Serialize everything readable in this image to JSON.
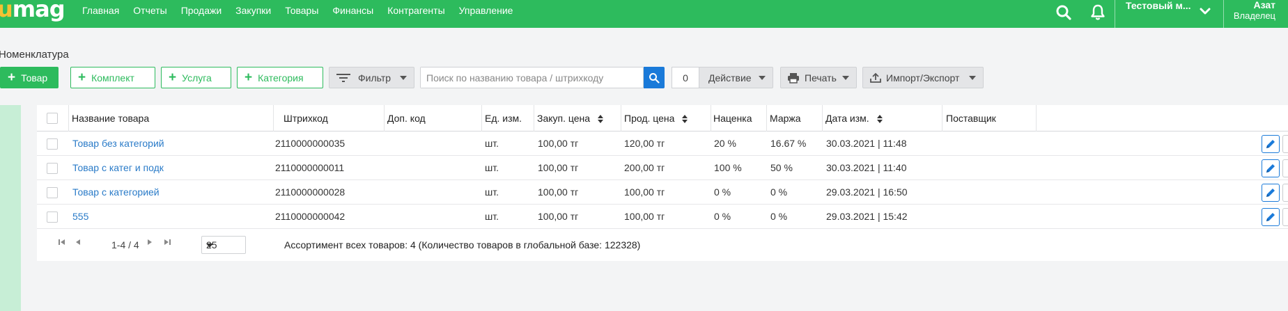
{
  "app": {
    "logo": "umag"
  },
  "nav": [
    "Главная",
    "Отчеты",
    "Продажи",
    "Закупки",
    "Товары",
    "Финансы",
    "Контрагенты",
    "Управление"
  ],
  "header": {
    "store_name": "Тестовый м...",
    "user_name": "Азат",
    "user_role": "Владелец"
  },
  "icons": {
    "search": "search-icon",
    "bell": "bell-icon",
    "chevron": "chevron-down-icon",
    "filter": "filter-icon",
    "print": "printer-icon",
    "import_export": "upload-icon",
    "edit": "pencil-icon",
    "sort": "sort-icon"
  },
  "colors": {
    "brand": "#2dbb5d",
    "link": "#2a7bc8",
    "accent": "#1a7ad9"
  },
  "breadcrumb": "Номенклатура",
  "toolbar": {
    "add_product": "Товар",
    "add_kit": "Комплект",
    "add_service": "Услуга",
    "add_category": "Категория",
    "filter": "Фильтр",
    "search_placeholder": "Поиск по названию товара / штрихкоду",
    "selected_count": "0",
    "action": "Действие",
    "print": "Печать",
    "import_export": "Импорт/Экспорт"
  },
  "table": {
    "columns": [
      "Название товара",
      "Штрихкод",
      "Доп. код",
      "Ед. изм.",
      "Закуп. цена",
      "Прод. цена",
      "Наценка",
      "Маржа",
      "Дата изм.",
      "Поставщик"
    ],
    "rows": [
      {
        "name": "Товар без категорий",
        "barcode": "2110000000035",
        "extra_code": "",
        "unit": "шт.",
        "purchase": "100,00 тг",
        "sale": "120,00 тг",
        "markup": "20 %",
        "margin": "16.67 %",
        "date": "30.03.2021 | 11:48",
        "supplier": ""
      },
      {
        "name": "Товар с катег и подк",
        "barcode": "2110000000011",
        "extra_code": "",
        "unit": "шт.",
        "purchase": "100,00 тг",
        "sale": "200,00 тг",
        "markup": "100 %",
        "margin": "50 %",
        "date": "30.03.2021 | 11:40",
        "supplier": ""
      },
      {
        "name": "Товар с категорией",
        "barcode": "2110000000028",
        "extra_code": "",
        "unit": "шт.",
        "purchase": "100,00 тг",
        "sale": "100,00 тг",
        "markup": "0 %",
        "margin": "0 %",
        "date": "29.03.2021 | 16:50",
        "supplier": ""
      },
      {
        "name": "555",
        "barcode": "2110000000042",
        "extra_code": "",
        "unit": "шт.",
        "purchase": "100,00 тг",
        "sale": "100,00 тг",
        "markup": "0 %",
        "margin": "0 %",
        "date": "29.03.2021 | 15:42",
        "supplier": ""
      }
    ]
  },
  "pagination": {
    "range": "1-4 / 4",
    "per_page": "25"
  },
  "summary": "Ассортимент всех товаров: 4 (Количество товаров в глобальной базе: 122328)"
}
